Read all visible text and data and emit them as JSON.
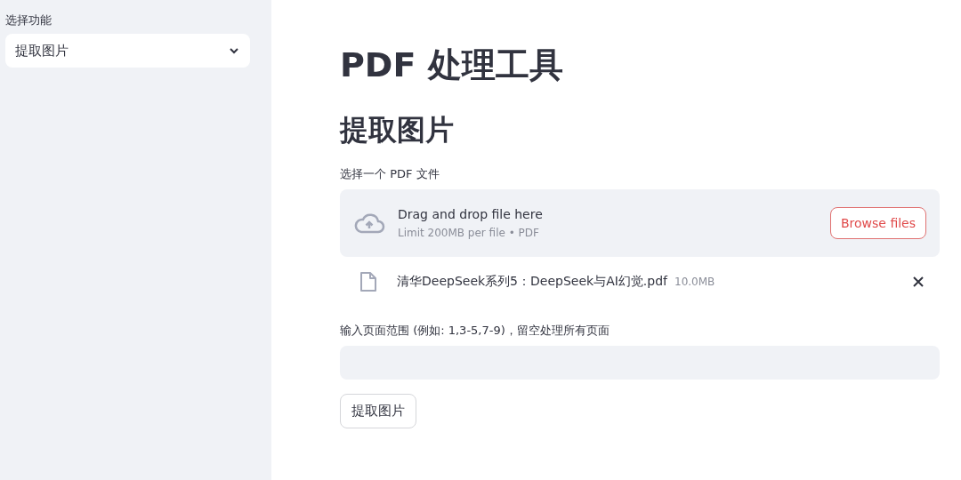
{
  "sidebar": {
    "select_label": "选择功能",
    "select_value": "提取图片"
  },
  "main": {
    "title": "PDF 处理工具",
    "subtitle": "提取图片",
    "uploader": {
      "label": "选择一个 PDF 文件",
      "drop_text": "Drag and drop file here",
      "limit_text": "Limit 200MB per file • PDF",
      "browse_button": "Browse files"
    },
    "file": {
      "name": "清华DeepSeek系列5：DeepSeek与AI幻觉.pdf",
      "size": "10.0MB"
    },
    "range_input": {
      "label": "输入页面范围 (例如: 1,3-5,7-9)，留空处理所有页面"
    },
    "action_button": "提取图片"
  }
}
